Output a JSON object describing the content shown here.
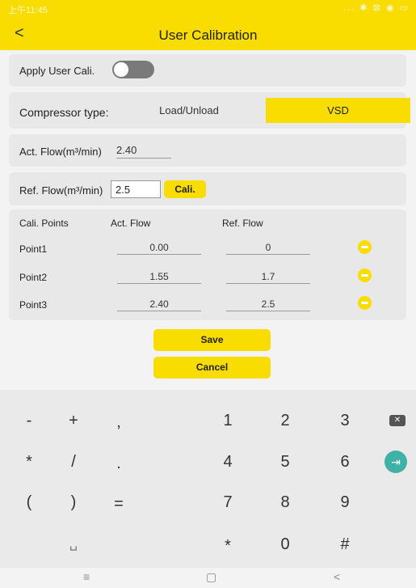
{
  "status_bar": {
    "time": "上午11:45",
    "icons": "... ✱ ⊠ ◉ ▭"
  },
  "header": {
    "back_icon": "chevron-left-icon",
    "back_glyph": "<",
    "title": "User Calibration"
  },
  "apply": {
    "label": "Apply User Cali.",
    "enabled": false
  },
  "compressor": {
    "label": "Compressor type:",
    "options": [
      "Load/Unload",
      "VSD"
    ],
    "selected": "VSD"
  },
  "act_flow": {
    "label": "Act. Flow(m³/min)",
    "value": "2.40"
  },
  "ref_flow": {
    "label": "Ref. Flow(m³/min)",
    "value": "2.5",
    "cali_label": "Cali."
  },
  "points_table": {
    "headers": [
      "Cali. Points",
      "Act. Flow",
      "Ref. Flow"
    ],
    "rows": [
      {
        "name": "Point1",
        "act": "0.00",
        "ref": "0"
      },
      {
        "name": "Point2",
        "act": "1.55",
        "ref": "1.7"
      },
      {
        "name": "Point3",
        "act": "2.40",
        "ref": "2.5"
      }
    ]
  },
  "actions": {
    "save": "Save",
    "cancel": "Cancel"
  },
  "keyboard": {
    "row1": [
      "-",
      "+",
      ",",
      "1",
      "2",
      "3"
    ],
    "row2": [
      "*",
      "/",
      ".",
      "4",
      "5",
      "6"
    ],
    "row3": [
      "(",
      ")",
      "=",
      "7",
      "8",
      "9"
    ],
    "row4": [
      "␣",
      "*",
      "0",
      "#"
    ],
    "backspace_glyph": "✕",
    "tab_glyph": "⇥"
  },
  "navbar": {
    "menu": "≡",
    "home": "▢",
    "back": "<"
  },
  "colors": {
    "accent": "#f9dd00",
    "tab_key": "#3fb1a6"
  }
}
